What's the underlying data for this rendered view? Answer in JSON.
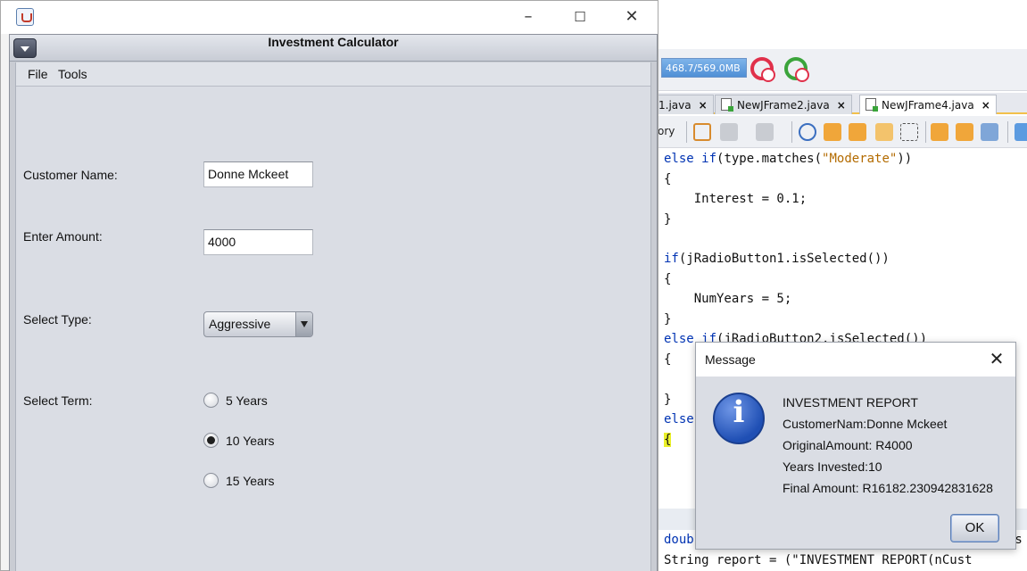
{
  "ide": {
    "memory": "468.7/569.0MB",
    "tabs": [
      {
        "label": "1.java",
        "active": false
      },
      {
        "label": "NewJFrame2.java",
        "active": false
      },
      {
        "label": "NewJFrame4.java",
        "active": true
      }
    ],
    "toolbar_text": "ory",
    "code_lines": [
      "else if(type.matches(\"Moderate\"))",
      "{",
      "    Interest = 0.1;",
      "}",
      "",
      "if(jRadioButton1.isSelected())",
      "{",
      "    NumYears = 5;",
      "}",
      "else if(jRadioButton2.isSelected())",
      "{",
      "",
      "}",
      "else",
      "{"
    ],
    "code_bottom_1": "doub",
    "code_bottom_1_tail": "es",
    "code_bottom_2": "String report = (\"INVESTMENT REPORT(nCust"
  },
  "app": {
    "os_title": "",
    "frame_title": "Investment Calculator",
    "menu": [
      "File",
      "Tools"
    ],
    "form": {
      "name_label": "Customer Name:",
      "name_value": "Donne Mckeet",
      "amount_label": "Enter Amount:",
      "amount_value": "4000",
      "type_label": "Select Type:",
      "type_value": "Aggressive",
      "term_label": "Select Term:",
      "terms": [
        "5 Years",
        "10 Years",
        "15 Years"
      ],
      "selected_term": "10 Years"
    }
  },
  "dialog": {
    "title": "Message",
    "icon": "info-icon",
    "lines": [
      "INVESTMENT REPORT",
      "CustomerNam:Donne Mckeet",
      "OriginalAmount: R4000",
      "Years Invested:10",
      "Final Amount: R16182.230942831628"
    ],
    "ok": "OK"
  }
}
